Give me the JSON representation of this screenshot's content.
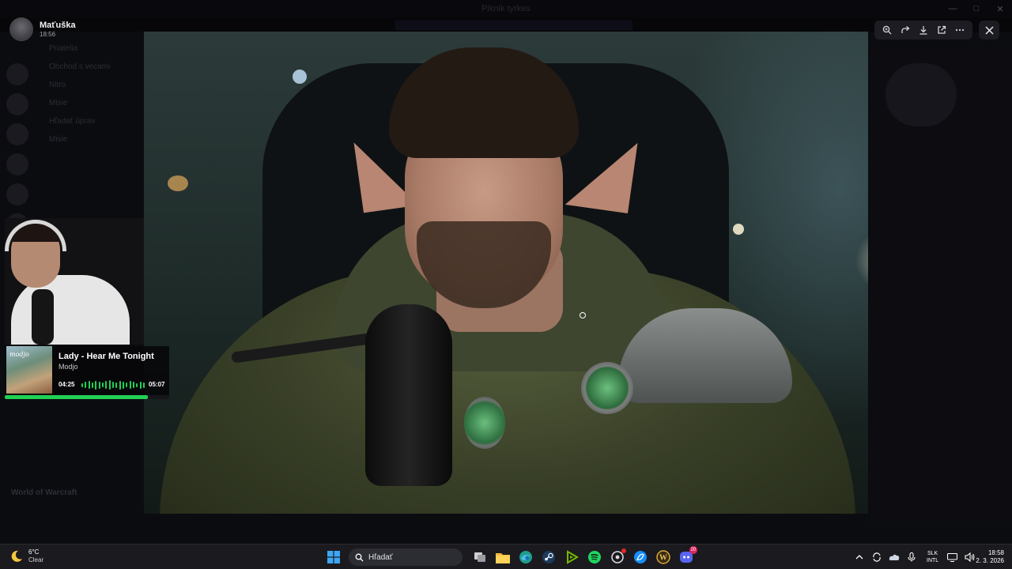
{
  "background_app": {
    "window_title": "Piknik tyrkes",
    "sidebar_items": [
      "Priatelia",
      "Obchod s vecami",
      "Nitro",
      "Misie",
      "Hľadať úprav",
      "Misie"
    ],
    "game_label": "World of Warcraft"
  },
  "viewer": {
    "author_name": "Maťuška",
    "timestamp": "18:56",
    "toolbar_icons": [
      "zoom-icon",
      "forward-icon",
      "download-icon",
      "open-external-icon",
      "more-icon"
    ],
    "close_icon": "close-icon"
  },
  "now_playing": {
    "title": "Lady - Hear Me Tonight",
    "artist": "Modjo",
    "current_time": "04:25",
    "total_time": "05:07",
    "progress": 0.87,
    "accent_color": "#21d054"
  },
  "taskbar": {
    "weather_temp": "6°C",
    "weather_condition": "Clear",
    "search_placeholder": "Hľadať",
    "notification_badge": "20",
    "language_line1": "SLK",
    "language_line2": "INTL",
    "time": "18:58",
    "date": "2. 3. 2026"
  }
}
